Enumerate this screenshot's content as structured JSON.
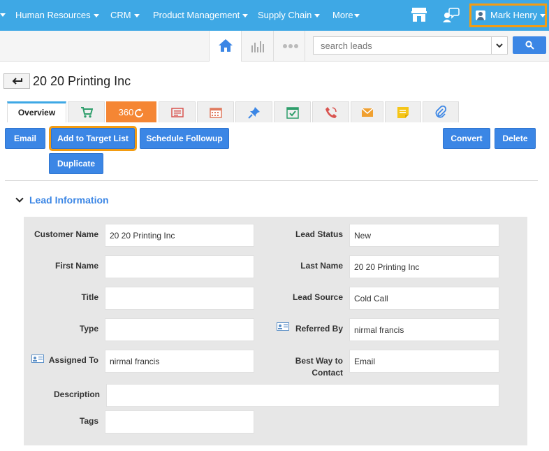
{
  "nav": {
    "items": [
      {
        "label": "Human Resources"
      },
      {
        "label": "CRM"
      },
      {
        "label": "Product Management"
      },
      {
        "label": "Supply Chain"
      },
      {
        "label": "More"
      }
    ],
    "user_name": "Mark Henry"
  },
  "search": {
    "placeholder": "search leads"
  },
  "page": {
    "title": "20 20 Printing Inc"
  },
  "tabs": {
    "overview": "Overview",
    "t360": "360"
  },
  "actions": {
    "email": "Email",
    "add_to_target_list": "Add to Target List",
    "schedule_followup": "Schedule Followup",
    "convert": "Convert",
    "delete": "Delete",
    "duplicate": "Duplicate"
  },
  "section": {
    "title": "Lead Information"
  },
  "fields": {
    "customer_name": {
      "label": "Customer Name",
      "value": "20 20 Printing Inc"
    },
    "lead_status": {
      "label": "Lead Status",
      "value": "New"
    },
    "first_name": {
      "label": "First Name",
      "value": ""
    },
    "last_name": {
      "label": "Last Name",
      "value": "20 20 Printing Inc"
    },
    "title": {
      "label": "Title",
      "value": ""
    },
    "lead_source": {
      "label": "Lead Source",
      "value": "Cold Call"
    },
    "type": {
      "label": "Type",
      "value": ""
    },
    "referred_by": {
      "label": "Referred By",
      "value": "nirmal francis"
    },
    "assigned_to": {
      "label": "Assigned To",
      "value": "nirmal francis"
    },
    "best_way_line1": "Best Way to",
    "best_way_line2": "Contact",
    "best_way_value": "Email",
    "description": {
      "label": "Description",
      "value": ""
    },
    "tags": {
      "label": "Tags",
      "value": ""
    }
  },
  "colors": {
    "nav_bg": "#3ea8e5",
    "button_bg": "#3b86e5",
    "highlight": "#f39c12",
    "tab_360": "#f58634"
  }
}
